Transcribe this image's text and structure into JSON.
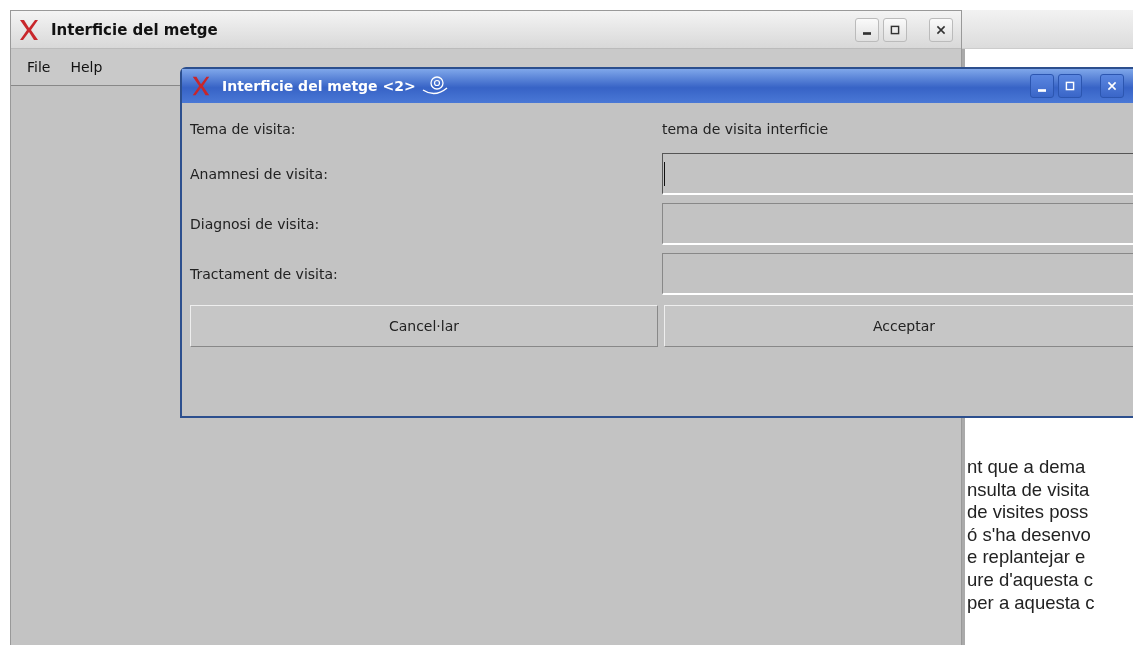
{
  "main_window": {
    "title": "Interficie del metge",
    "menu": [
      "File",
      "Help"
    ]
  },
  "document": {
    "lines": [
      "nt que a dema",
      "nsulta de visita",
      "de visites poss",
      "ó s'ha desenvo",
      "e replantejar e",
      "ure d'aquesta c",
      "per a aquesta c"
    ]
  },
  "dialog": {
    "title": "Interficie del metge <2>",
    "rows": [
      {
        "kind": "text",
        "label": "Tema de visita:",
        "value": "tema de visita interficie"
      },
      {
        "kind": "field",
        "label": "Anamnesi de visita:",
        "focused": true
      },
      {
        "kind": "field",
        "label": "Diagnosi de visita:",
        "focused": false
      },
      {
        "kind": "field",
        "label": "Tractament de visita:",
        "focused": false
      }
    ],
    "buttons": [
      "Cancel·lar",
      "Acceptar"
    ]
  }
}
